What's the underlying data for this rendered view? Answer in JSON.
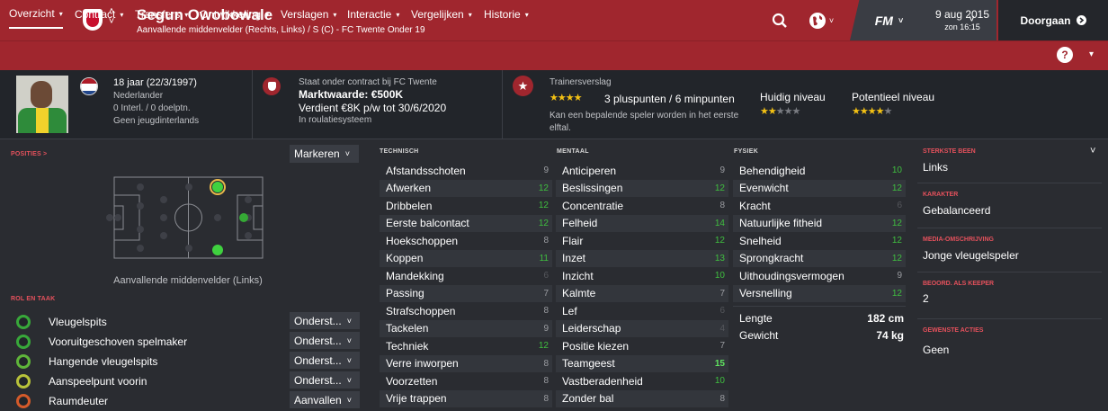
{
  "header": {
    "player_name": "Segun Owobowale",
    "subtitle": "Aanvallende middenvelder (Rechts, Links) / S (C) - FC Twente Onder 19",
    "date": "9 aug 2015",
    "time": "zon 16:15",
    "fm_label": "FM",
    "continue_label": "Doorgaan",
    "back_icon": "chevron-left-icon",
    "forward_icon": "chevron-right-icon"
  },
  "tabs": [
    {
      "label": "Overzicht",
      "active": true
    },
    {
      "label": "Contract"
    },
    {
      "label": "Transfers"
    },
    {
      "label": "Ontwikkeling"
    },
    {
      "label": "Verslagen"
    },
    {
      "label": "Interactie"
    },
    {
      "label": "Vergelijken"
    },
    {
      "label": "Historie"
    }
  ],
  "info": {
    "age": "18 jaar (22/3/1997)",
    "nationality": "Nederlander",
    "caps": "0 Interl. / 0 doelptn.",
    "youth_caps": "Geen jeugdinterlands",
    "contract_note": "Staat onder contract bij FC Twente",
    "market_value": "Marktwaarde: €500K",
    "wage": "Verdient €8K p/w tot 30/6/2020",
    "squad_status": "In roulatiesysteem",
    "scout_report_title": "Trainersverslag",
    "scout_stars": 4,
    "scout_points": "3 pluspunten / 6 minpunten",
    "scout_note": "Kan een bepalende speler worden in het eerste elftal.",
    "current_ability_label": "Huidig niveau",
    "current_ability_stars": 2,
    "potential_ability_label": "Potentieel niveau",
    "potential_ability_stars": 4
  },
  "positions": {
    "header": "POSITIES >",
    "mark_button": "Markeren",
    "label": "Aanvallende middenvelder (Links)"
  },
  "roles": {
    "header": "ROL EN TAAK",
    "items": [
      {
        "name": "Vleugelspits",
        "duty": "Onderst..."
      },
      {
        "name": "Vooruitgeschoven spelmaker",
        "duty": "Onderst..."
      },
      {
        "name": "Hangende vleugelspits",
        "duty": "Onderst..."
      },
      {
        "name": "Aanspeelpunt voorin",
        "duty": "Onderst..."
      },
      {
        "name": "Raumdeuter",
        "duty": "Aanvallen"
      }
    ]
  },
  "technical": {
    "header": "TECHNISCH",
    "items": [
      {
        "name": "Afstandsschoten",
        "value": "9"
      },
      {
        "name": "Afwerken",
        "value": "12"
      },
      {
        "name": "Dribbelen",
        "value": "12"
      },
      {
        "name": "Eerste balcontact",
        "value": "12"
      },
      {
        "name": "Hoekschoppen",
        "value": "8"
      },
      {
        "name": "Koppen",
        "value": "11"
      },
      {
        "name": "Mandekking",
        "value": "6"
      },
      {
        "name": "Passing",
        "value": "7"
      },
      {
        "name": "Strafschoppen",
        "value": "8"
      },
      {
        "name": "Tackelen",
        "value": "9"
      },
      {
        "name": "Techniek",
        "value": "12"
      },
      {
        "name": "Verre inworpen",
        "value": "8"
      },
      {
        "name": "Voorzetten",
        "value": "8"
      },
      {
        "name": "Vrije trappen",
        "value": "8"
      }
    ]
  },
  "mental": {
    "header": "MENTAAL",
    "items": [
      {
        "name": "Anticiperen",
        "value": "9"
      },
      {
        "name": "Beslissingen",
        "value": "12"
      },
      {
        "name": "Concentratie",
        "value": "8"
      },
      {
        "name": "Felheid",
        "value": "14"
      },
      {
        "name": "Flair",
        "value": "12"
      },
      {
        "name": "Inzet",
        "value": "13"
      },
      {
        "name": "Inzicht",
        "value": "10"
      },
      {
        "name": "Kalmte",
        "value": "7"
      },
      {
        "name": "Lef",
        "value": "6"
      },
      {
        "name": "Leiderschap",
        "value": "4"
      },
      {
        "name": "Positie kiezen",
        "value": "7"
      },
      {
        "name": "Teamgeest",
        "value": "15"
      },
      {
        "name": "Vastberadenheid",
        "value": "10"
      },
      {
        "name": "Zonder bal",
        "value": "8"
      }
    ]
  },
  "physical": {
    "header": "FYSIEK",
    "items": [
      {
        "name": "Behendigheid",
        "value": "10"
      },
      {
        "name": "Evenwicht",
        "value": "12"
      },
      {
        "name": "Kracht",
        "value": "6"
      },
      {
        "name": "Natuurlijke fitheid",
        "value": "12"
      },
      {
        "name": "Snelheid",
        "value": "12"
      },
      {
        "name": "Sprongkracht",
        "value": "12"
      },
      {
        "name": "Uithoudingsvermogen",
        "value": "9"
      },
      {
        "name": "Versnelling",
        "value": "12"
      }
    ],
    "height_label": "Lengte",
    "height_value": "182 cm",
    "weight_label": "Gewicht",
    "weight_value": "74 kg"
  },
  "side": {
    "foot_header": "STERKSTE BEEN",
    "foot_value": "Links",
    "personality_header": "KARAKTER",
    "personality_value": "Gebalanceerd",
    "media_header": "MEDIA-OMSCHRIJVING",
    "media_value": "Jonge vleugelspeler",
    "gk_header": "BEOORD. ALS KEEPER",
    "gk_value": "2",
    "moves_header": "GEWENSTE ACTIES",
    "moves_value": "Geen"
  },
  "colors": {
    "accent": "#a0262e",
    "attr_good": "#3fbf3f",
    "star": "#f3c114"
  }
}
